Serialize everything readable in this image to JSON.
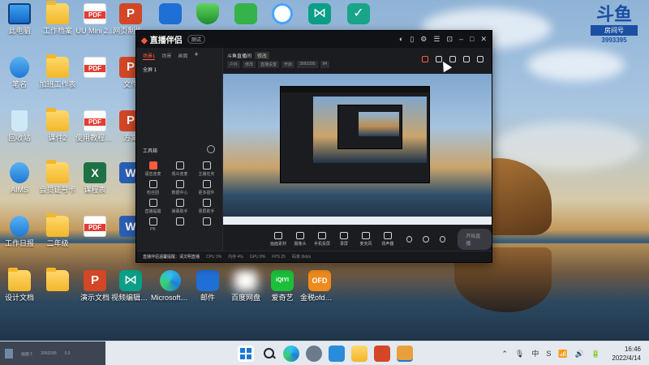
{
  "desktop": {
    "icons": [
      {
        "label": "此电脑",
        "icon": "monitor-icon"
      },
      {
        "label": "工作档案",
        "icon": "folder-icon"
      },
      {
        "label": "UU Mini 2...",
        "icon": "pdf-file-icon"
      },
      {
        "label": "网页制作...",
        "icon": "ppt-file-icon"
      },
      {
        "label": "",
        "icon": "bird-app-icon"
      },
      {
        "label": "",
        "icon": "security-shield-icon"
      },
      {
        "label": "",
        "icon": "music-app-icon"
      },
      {
        "label": "",
        "icon": "360-browser-icon"
      },
      {
        "label": "",
        "icon": "vsx-app-icon"
      },
      {
        "label": "",
        "icon": "task-check-icon"
      },
      {
        "label": "笔名",
        "icon": "user-folder-icon"
      },
      {
        "label": "加班工作表",
        "icon": "folder-icon"
      },
      {
        "label": "",
        "icon": "pdf-file-icon"
      },
      {
        "label": "文件",
        "icon": "ppt-file-icon"
      },
      {
        "label": "回收站",
        "icon": "recycle-bin-icon"
      },
      {
        "label": "课件2",
        "icon": "folder-icon"
      },
      {
        "label": "使用教程学习",
        "icon": "pdf-file-icon"
      },
      {
        "label": "方案",
        "icon": "ppt-file-icon"
      },
      {
        "label": "AIMS",
        "icon": "user-folder-icon"
      },
      {
        "label": "会员证号卡",
        "icon": "folder-icon"
      },
      {
        "label": "课程表",
        "icon": "excel-file-icon"
      },
      {
        "label": "",
        "icon": "word-file-icon"
      },
      {
        "label": "工作日报",
        "icon": "user-folder-icon"
      },
      {
        "label": "二年级",
        "icon": "folder-icon"
      },
      {
        "label": "",
        "icon": "pdf-file-icon"
      },
      {
        "label": "",
        "icon": "word-file-icon"
      },
      {
        "label": "设计文档",
        "icon": "folder-icon"
      },
      {
        "label": "",
        "icon": "folder-icon"
      },
      {
        "label": "演示文档",
        "icon": "ppt-file-icon"
      },
      {
        "label": "视频编辑软件",
        "icon": "vsx-app-icon"
      },
      {
        "label": "Microsoft Edge",
        "icon": "edge-icon"
      },
      {
        "label": "邮件",
        "icon": "bird-app-icon"
      },
      {
        "label": "百度网盘",
        "icon": "cloud-drive-icon"
      },
      {
        "label": "爱奇艺",
        "icon": "iqiyi-icon"
      },
      {
        "label": "金税ofd电子发票阅读器",
        "icon": "ofd-reader-icon"
      }
    ]
  },
  "watermark": {
    "logo": "斗鱼",
    "sub": "房间号",
    "room": "3993395"
  },
  "app": {
    "name": "直播伴侣",
    "badge": "测试",
    "left_tabs": [
      "场景1",
      "场景",
      "画面"
    ],
    "add_tab": "+",
    "scene_item": "全屏 1",
    "tools_title": "工具箱",
    "tools": [
      {
        "label": "语音连麦",
        "hot": true
      },
      {
        "label": "观众连麦",
        "hot": false
      },
      {
        "label": "主播任务",
        "hot": false
      },
      {
        "label": "粉丝团",
        "hot": false
      },
      {
        "label": "数据中心",
        "hot": false
      },
      {
        "label": "更多插件",
        "hot": false
      },
      {
        "label": "直播提醒",
        "hot": false
      },
      {
        "label": "弹幕助手",
        "hot": false
      },
      {
        "label": "录屏助手",
        "hot": false
      },
      {
        "label": "PK",
        "hot": false
      },
      {
        "label": "",
        "hot": false
      },
      {
        "label": "",
        "hot": false
      }
    ],
    "room_title": "斗鱼直播间",
    "room_tag": "修改",
    "room_meta": [
      "户外",
      "修改",
      "直播设置",
      "开启",
      "3993395",
      "84"
    ],
    "bottom_buttons": [
      "画面素材",
      "摄像头",
      "手机投屏",
      "录屏",
      "麦克风",
      "扬声器"
    ],
    "go_live": "开始直播",
    "status": {
      "notice": "直播伴侣温馨提醒：请文明直播",
      "items": [
        "CPU 3%",
        "内存 4%",
        "GPU 8%",
        "FPS 25",
        "码率 0kb/s"
      ]
    }
  },
  "taskbar": {
    "left_text": [
      "画面 1",
      "3993395",
      "0.0"
    ],
    "apps": [
      "start-icon",
      "search-icon",
      "edge-icon",
      "settings-icon",
      "photos-icon",
      "file-explorer-icon",
      "powerpoint-icon",
      "live-app-icon"
    ],
    "tray": [
      "⌃",
      "🎙",
      "中",
      "S",
      "📶",
      "🔊",
      "🔋"
    ],
    "time": "16:46",
    "date": "2022/4/14"
  },
  "colors": {
    "accent": "#ff5a3c",
    "taskbar": "#ecf0f6",
    "app_bg": "#1b1c20"
  }
}
